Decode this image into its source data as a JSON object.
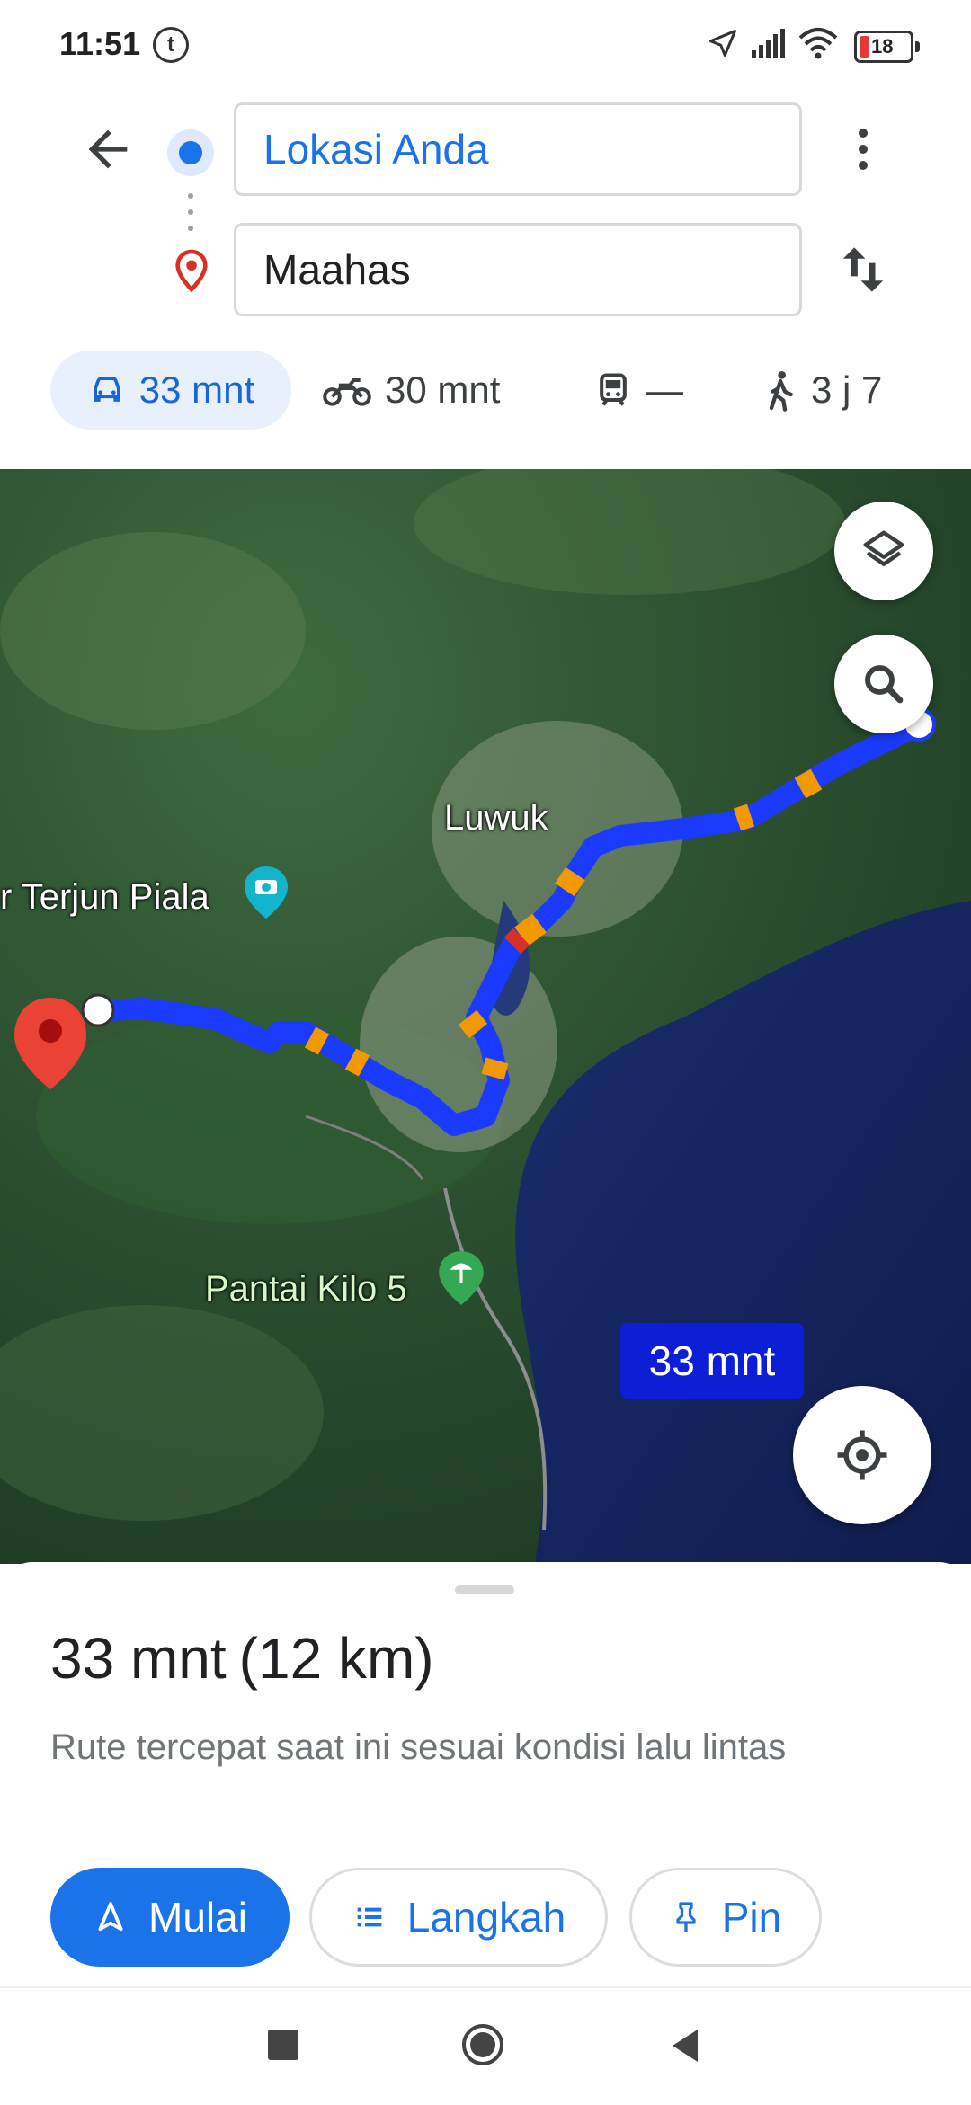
{
  "status_bar": {
    "time": "11:51",
    "app_badge": "t",
    "battery_level": "18"
  },
  "route": {
    "origin": "Lokasi Anda",
    "destination": "Maahas"
  },
  "travel_modes": [
    {
      "mode": "car",
      "label": "33 mnt",
      "selected": true
    },
    {
      "mode": "motorcycle",
      "label": "30 mnt"
    },
    {
      "mode": "transit",
      "label": "—"
    },
    {
      "mode": "walk",
      "label": "3 j 7"
    }
  ],
  "map": {
    "labels": {
      "city": "Luwuk",
      "waterfall": "r Terjun Piala",
      "beach": "Pantai Kilo 5"
    },
    "route_callout": "33 mnt",
    "colors": {
      "route": "#1a3bff",
      "traffic": "#f29900",
      "jam": "#d93025",
      "pin": "#ea4335"
    }
  },
  "summary": {
    "duration": "33 mnt",
    "distance": "(12 km)",
    "description": "Rute tercepat saat ini sesuai kondisi lalu lintas"
  },
  "actions": {
    "start": "Mulai",
    "steps": "Langkah",
    "pin": "Pin"
  }
}
